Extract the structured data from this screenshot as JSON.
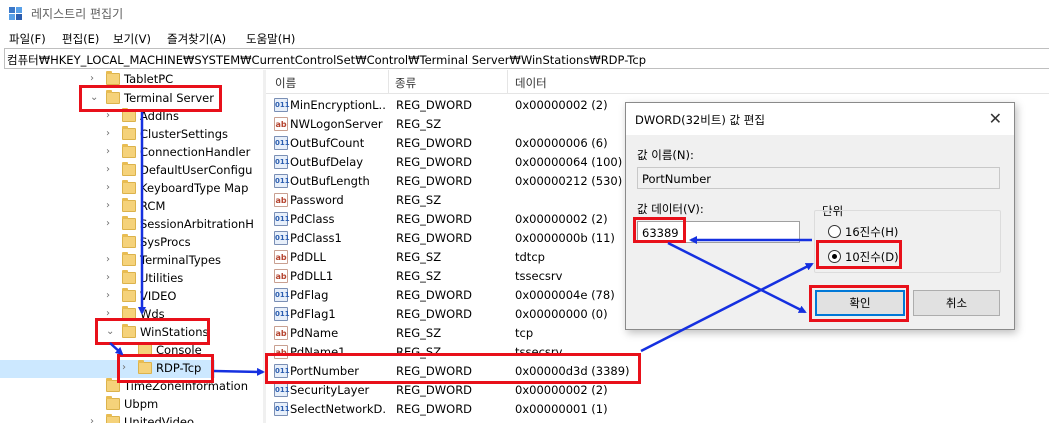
{
  "window": {
    "title": "레지스트리 편집기"
  },
  "menu": [
    "파일(F)",
    "편집(E)",
    "보기(V)",
    "즐겨찾기(A)",
    "도움말(H)"
  ],
  "address": "컴퓨터₩HKEY_LOCAL_MACHINE₩SYSTEM₩CurrentControlSet₩Control₩Terminal Server₩WinStations₩RDP-Tcp",
  "tree": [
    {
      "label": "TabletPC",
      "chevron": "›"
    },
    {
      "label": "Terminal Server",
      "chevron": "⌄"
    },
    {
      "label": "AddIns",
      "chevron": "›"
    },
    {
      "label": "ClusterSettings",
      "chevron": "›"
    },
    {
      "label": "ConnectionHandler",
      "chevron": "›"
    },
    {
      "label": "DefaultUserConfigu",
      "chevron": "›"
    },
    {
      "label": "KeyboardType Map",
      "chevron": "›"
    },
    {
      "label": "RCM",
      "chevron": "›"
    },
    {
      "label": "SessionArbitrationH",
      "chevron": "›"
    },
    {
      "label": "SysProcs",
      "chevron": ""
    },
    {
      "label": "TerminalTypes",
      "chevron": "›"
    },
    {
      "label": "Utilities",
      "chevron": "›"
    },
    {
      "label": "VIDEO",
      "chevron": "›"
    },
    {
      "label": "Wds",
      "chevron": "›"
    },
    {
      "label": "WinStations",
      "chevron": "⌄"
    },
    {
      "label": "Console",
      "chevron": ""
    },
    {
      "label": "RDP-Tcp",
      "chevron": "›"
    },
    {
      "label": "TimeZoneInformation",
      "chevron": ""
    },
    {
      "label": "Ubpm",
      "chevron": ""
    },
    {
      "label": "UnitedVideo",
      "chevron": "›"
    }
  ],
  "list": {
    "headers": [
      "이름",
      "종류",
      "데이터"
    ],
    "rows": [
      {
        "name": "MinEncryptionL...",
        "type": "REG_DWORD",
        "data": "0x00000002 (2)",
        "icon": "dword"
      },
      {
        "name": "NWLogonServer",
        "type": "REG_SZ",
        "data": "",
        "icon": "sz"
      },
      {
        "name": "OutBufCount",
        "type": "REG_DWORD",
        "data": "0x00000006 (6)",
        "icon": "dword"
      },
      {
        "name": "OutBufDelay",
        "type": "REG_DWORD",
        "data": "0x00000064 (100)",
        "icon": "dword"
      },
      {
        "name": "OutBufLength",
        "type": "REG_DWORD",
        "data": "0x00000212 (530)",
        "icon": "dword"
      },
      {
        "name": "Password",
        "type": "REG_SZ",
        "data": "",
        "icon": "sz"
      },
      {
        "name": "PdClass",
        "type": "REG_DWORD",
        "data": "0x00000002 (2)",
        "icon": "dword"
      },
      {
        "name": "PdClass1",
        "type": "REG_DWORD",
        "data": "0x0000000b (11)",
        "icon": "dword"
      },
      {
        "name": "PdDLL",
        "type": "REG_SZ",
        "data": "tdtcp",
        "icon": "sz"
      },
      {
        "name": "PdDLL1",
        "type": "REG_SZ",
        "data": "tssecsrv",
        "icon": "sz"
      },
      {
        "name": "PdFlag",
        "type": "REG_DWORD",
        "data": "0x0000004e (78)",
        "icon": "dword"
      },
      {
        "name": "PdFlag1",
        "type": "REG_DWORD",
        "data": "0x00000000 (0)",
        "icon": "dword"
      },
      {
        "name": "PdName",
        "type": "REG_SZ",
        "data": "tcp",
        "icon": "sz"
      },
      {
        "name": "PdName1",
        "type": "REG_SZ",
        "data": "tssecsrv",
        "icon": "sz"
      },
      {
        "name": "PortNumber",
        "type": "REG_DWORD",
        "data": "0x00000d3d (3389)",
        "icon": "dword"
      },
      {
        "name": "SecurityLayer",
        "type": "REG_DWORD",
        "data": "0x00000002 (2)",
        "icon": "dword"
      },
      {
        "name": "SelectNetworkD...",
        "type": "REG_DWORD",
        "data": "0x00000001 (1)",
        "icon": "dword"
      }
    ]
  },
  "dialog": {
    "title": "DWORD(32비트) 값 편집",
    "name_label": "값 이름(N):",
    "name_value": "PortNumber",
    "data_label": "값 데이터(V):",
    "data_value": "63389",
    "unit_label": "단위",
    "hex_label": "16진수(H)",
    "dec_label": "10진수(D)",
    "selected_unit": "dec",
    "ok": "확인",
    "cancel": "취소",
    "close_icon": "✕"
  },
  "annotation_color": "#e8101a",
  "arrow_color": "#1530e0"
}
